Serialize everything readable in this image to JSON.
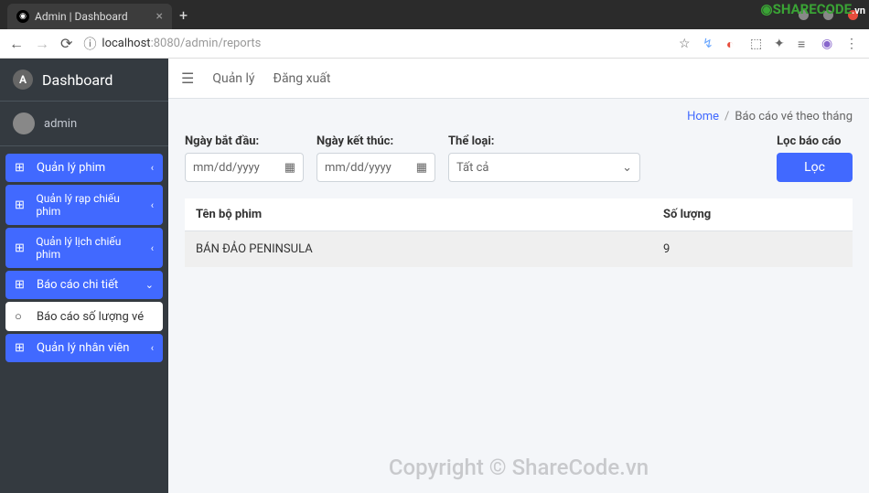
{
  "browser": {
    "tab_title": "Admin | Dashboard",
    "url_host": "localhost",
    "url_port": ":8080",
    "url_path": "/admin/reports"
  },
  "sidebar": {
    "brand": "Dashboard",
    "user": "admin",
    "items": [
      {
        "label": "Quản lý phim",
        "type": "blue"
      },
      {
        "label": "Quản lý rạp chiếu phim",
        "type": "blue"
      },
      {
        "label": "Quản lý lịch chiếu phim",
        "type": "blue"
      },
      {
        "label": "Báo cáo chi tiết",
        "type": "blue"
      },
      {
        "label": "Báo cáo số lượng vé",
        "type": "white"
      },
      {
        "label": "Quản lý nhân viên",
        "type": "blue"
      }
    ]
  },
  "topbar": {
    "link1": "Quản lý",
    "link2": "Đăng xuất"
  },
  "breadcrumb": {
    "home": "Home",
    "current": "Báo cáo vé theo tháng"
  },
  "filters": {
    "start_label": "Ngày bắt đầu:",
    "start_placeholder": "mm/dd/yyyy",
    "end_label": "Ngày kết thúc:",
    "end_placeholder": "mm/dd/yyyy",
    "genre_label": "Thể loại:",
    "genre_value": "Tất cả",
    "filter_label": "Lọc báo cáo",
    "filter_btn": "Lọc"
  },
  "table": {
    "col1": "Tên bộ phim",
    "col2": "Số lượng",
    "rows": [
      {
        "name": "BÁN ĐẢO PENINSULA",
        "qty": "9"
      }
    ]
  },
  "watermark1": "ShareCode.vn",
  "watermark2": "Copyright © ShareCode.vn",
  "logo_text": "SHARECODE",
  "logo_vn": ".vn"
}
